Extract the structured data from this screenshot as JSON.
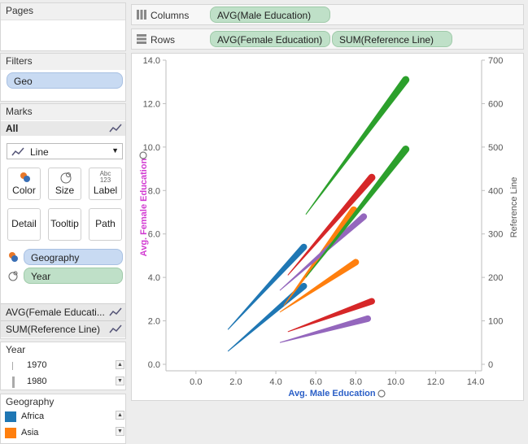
{
  "pages": {
    "title": "Pages"
  },
  "filters": {
    "title": "Filters",
    "pill": "Geo"
  },
  "marks": {
    "title": "Marks",
    "all_label": "All",
    "mark_type": "Line",
    "buttons": [
      "Color",
      "Size",
      "Label",
      "Detail",
      "Tooltip",
      "Path"
    ],
    "label_icon_text": "Abc\n123",
    "fields": [
      {
        "name": "Geography",
        "kind": "color"
      },
      {
        "name": "Year",
        "kind": "size"
      }
    ],
    "sub_cards": [
      "AVG(Female Educati...",
      "SUM(Reference Line)"
    ]
  },
  "year_legend": {
    "title": "Year",
    "items": [
      "1970",
      "1980"
    ]
  },
  "geo_legend": {
    "title": "Geography",
    "items": [
      {
        "label": "Africa",
        "color": "#1f77b4"
      },
      {
        "label": "Asia",
        "color": "#ff7f0e"
      }
    ]
  },
  "shelves": {
    "columns_label": "Columns",
    "columns_pills": [
      "AVG(Male Education)"
    ],
    "rows_label": "Rows",
    "rows_pills": [
      "AVG(Female Education)",
      "SUM(Reference Line)"
    ]
  },
  "chart_data": {
    "type": "line",
    "xlabel": "Avg. Male Education",
    "ylabel": "Avg. Female Education",
    "y2label": "Reference Line",
    "xlim": [
      -1.5,
      14.3
    ],
    "ylim": [
      -0.3,
      14
    ],
    "y2lim": [
      -15,
      700
    ],
    "x_ticks": [
      "0.0",
      "2.0",
      "4.0",
      "6.0",
      "8.0",
      "10.0",
      "12.0",
      "14.0"
    ],
    "y_ticks": [
      "0.0",
      "2.0",
      "4.0",
      "6.0",
      "8.0",
      "10.0",
      "12.0",
      "14.0"
    ],
    "y2_ticks": [
      "0",
      "100",
      "200",
      "300",
      "400",
      "500",
      "600",
      "700"
    ],
    "series": [
      {
        "name": "Africa",
        "color": "#1f77b4",
        "points": [
          [
            1.6,
            0.6
          ],
          [
            5.4,
            3.6
          ]
        ],
        "width": [
          1,
          8
        ]
      },
      {
        "name": "Africa",
        "color": "#1f77b4",
        "points": [
          [
            1.6,
            1.6
          ],
          [
            5.4,
            5.4
          ]
        ],
        "width": [
          1,
          8
        ]
      },
      {
        "name": "Asia",
        "color": "#ff7f0e",
        "points": [
          [
            4.2,
            2.4
          ],
          [
            8.0,
            4.7
          ]
        ],
        "width": [
          1,
          8
        ]
      },
      {
        "name": "Asia",
        "color": "#ff7f0e",
        "points": [
          [
            4.4,
            2.7
          ],
          [
            7.9,
            7.1
          ]
        ],
        "width": [
          1,
          9
        ]
      },
      {
        "name": "",
        "color": "#d62728",
        "points": [
          [
            4.6,
            1.5
          ],
          [
            8.8,
            2.9
          ]
        ],
        "width": [
          1,
          8
        ]
      },
      {
        "name": "",
        "color": "#d62728",
        "points": [
          [
            4.6,
            4.1
          ],
          [
            8.8,
            8.6
          ]
        ],
        "width": [
          1,
          9
        ]
      },
      {
        "name": "",
        "color": "#9467bd",
        "points": [
          [
            4.2,
            1.0
          ],
          [
            8.6,
            2.1
          ]
        ],
        "width": [
          1,
          8
        ]
      },
      {
        "name": "",
        "color": "#9467bd",
        "points": [
          [
            4.2,
            3.4
          ],
          [
            8.4,
            6.8
          ]
        ],
        "width": [
          1,
          8
        ]
      },
      {
        "name": "",
        "color": "#2ca02c",
        "points": [
          [
            5.5,
            6.9
          ],
          [
            10.5,
            13.1
          ]
        ],
        "width": [
          1,
          9
        ]
      },
      {
        "name": "",
        "color": "#2ca02c",
        "points": [
          [
            5.5,
            4.0
          ],
          [
            10.5,
            9.9
          ]
        ],
        "width": [
          1,
          9
        ]
      }
    ]
  }
}
